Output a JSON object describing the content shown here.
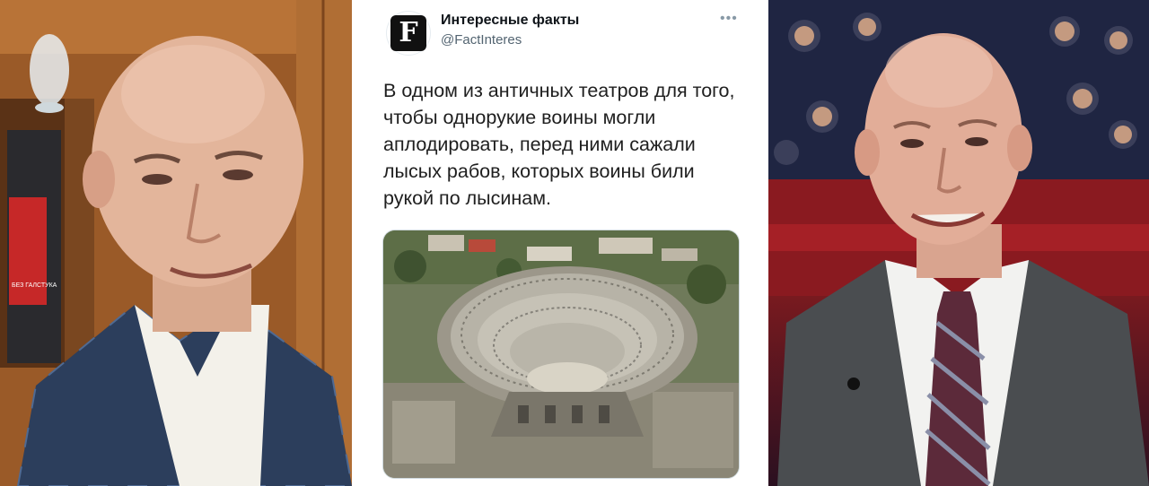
{
  "tweet": {
    "author_name": "Интересные факты",
    "author_handle": "@FactInteres",
    "avatar_letter": "F",
    "more_icon": "more-dots-icon",
    "text": "В одном из античных театров для того, чтобы однорукие воины могли аплодировать, перед ними сажали лысых рабов, которых воины били рукой по лысинам."
  },
  "left_photo": {
    "book_cover_text": "БЕЗ ГАЛСТУКА"
  }
}
